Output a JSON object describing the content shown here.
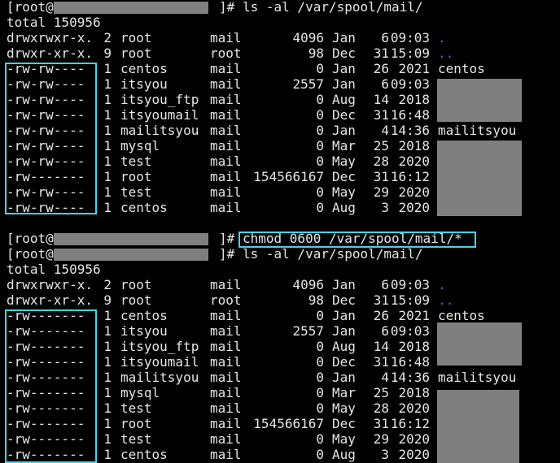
{
  "block1": {
    "prompt_user": "[root@",
    "prompt_tail": "]#",
    "command": "ls -al /var/spool/mail/",
    "total": "total 150956",
    "rows": [
      {
        "perm": "drwxrwxr-x.",
        "links": "2",
        "owner": "root",
        "group": "mail",
        "size": "4096",
        "month": "Jan",
        "day": "6",
        "time": "09:03",
        "name": "."
      },
      {
        "perm": "drwxr-xr-x.",
        "links": "9",
        "owner": "root",
        "group": "root",
        "size": "98",
        "month": "Dec",
        "day": "31",
        "time": "15:09",
        "name": ".."
      },
      {
        "perm": "-rw-rw----",
        "links": "1",
        "owner": "centos",
        "group": "mail",
        "size": "0",
        "month": "Jan",
        "day": "26",
        "time": "2021",
        "name": "centos"
      },
      {
        "perm": "-rw-rw----",
        "links": "1",
        "owner": "itsyou",
        "group": "mail",
        "size": "2557",
        "month": "Jan",
        "day": "6",
        "time": "09:03",
        "name": ""
      },
      {
        "perm": "-rw-rw----",
        "links": "1",
        "owner": "itsyou_ftp",
        "group": "mail",
        "size": "0",
        "month": "Aug",
        "day": "14",
        "time": "2018",
        "name": ""
      },
      {
        "perm": "-rw-rw----",
        "links": "1",
        "owner": "itsyoumail",
        "group": "mail",
        "size": "0",
        "month": "Dec",
        "day": "31",
        "time": "16:48",
        "name": ""
      },
      {
        "perm": "-rw-rw----",
        "links": "1",
        "owner": "mailitsyou",
        "group": "mail",
        "size": "0",
        "month": "Jan",
        "day": "4",
        "time": "14:36",
        "name": "mailitsyou"
      },
      {
        "perm": "-rw-rw----",
        "links": "1",
        "owner": "mysql",
        "group": "mail",
        "size": "0",
        "month": "Mar",
        "day": "25",
        "time": "2018",
        "name": ""
      },
      {
        "perm": "-rw-rw----",
        "links": "1",
        "owner": "test",
        "group": "mail",
        "size": "0",
        "month": "May",
        "day": "28",
        "time": "2020",
        "name": ""
      },
      {
        "perm": "-rw-------",
        "links": "1",
        "owner": "root",
        "group": "mail",
        "size": "154566167",
        "month": "Dec",
        "day": "31",
        "time": "16:12",
        "name": ""
      },
      {
        "perm": "-rw-rw----",
        "links": "1",
        "owner": "test",
        "group": "mail",
        "size": "0",
        "month": "May",
        "day": "29",
        "time": "2020",
        "name": ""
      },
      {
        "perm": "-rw-rw----",
        "links": "1",
        "owner": "centos",
        "group": "mail",
        "size": "0",
        "month": "Aug",
        "day": "3",
        "time": "2020",
        "name": ""
      }
    ]
  },
  "block2": {
    "chmod_prompt_user": "[root@",
    "chmod_prompt_tail": "]#",
    "chmod_command": "chmod 0600 /var/spool/mail/*",
    "prompt_user": "[root@",
    "prompt_tail": "]#",
    "command": "ls -al /var/spool/mail/",
    "total": "total 150956",
    "rows": [
      {
        "perm": "drwxrwxr-x.",
        "links": "2",
        "owner": "root",
        "group": "mail",
        "size": "4096",
        "month": "Jan",
        "day": "6",
        "time": "09:03",
        "name": "."
      },
      {
        "perm": "drwxr-xr-x.",
        "links": "9",
        "owner": "root",
        "group": "root",
        "size": "98",
        "month": "Dec",
        "day": "31",
        "time": "15:09",
        "name": ".."
      },
      {
        "perm": "-rw-------",
        "links": "1",
        "owner": "centos",
        "group": "mail",
        "size": "0",
        "month": "Jan",
        "day": "26",
        "time": "2021",
        "name": "centos"
      },
      {
        "perm": "-rw-------",
        "links": "1",
        "owner": "itsyou",
        "group": "mail",
        "size": "2557",
        "month": "Jan",
        "day": "6",
        "time": "09:03",
        "name": ""
      },
      {
        "perm": "-rw-------",
        "links": "1",
        "owner": "itsyou_ftp",
        "group": "mail",
        "size": "0",
        "month": "Aug",
        "day": "14",
        "time": "2018",
        "name": ""
      },
      {
        "perm": "-rw-------",
        "links": "1",
        "owner": "itsyoumail",
        "group": "mail",
        "size": "0",
        "month": "Dec",
        "day": "31",
        "time": "16:48",
        "name": ""
      },
      {
        "perm": "-rw-------",
        "links": "1",
        "owner": "mailitsyou",
        "group": "mail",
        "size": "0",
        "month": "Jan",
        "day": "4",
        "time": "14:36",
        "name": "mailitsyou"
      },
      {
        "perm": "-rw-------",
        "links": "1",
        "owner": "mysql",
        "group": "mail",
        "size": "0",
        "month": "Mar",
        "day": "25",
        "time": "2018",
        "name": ""
      },
      {
        "perm": "-rw-------",
        "links": "1",
        "owner": "test",
        "group": "mail",
        "size": "0",
        "month": "May",
        "day": "28",
        "time": "2020",
        "name": ""
      },
      {
        "perm": "-rw-------",
        "links": "1",
        "owner": "root",
        "group": "mail",
        "size": "154566167",
        "month": "Dec",
        "day": "31",
        "time": "16:12",
        "name": ""
      },
      {
        "perm": "-rw-------",
        "links": "1",
        "owner": "test",
        "group": "mail",
        "size": "0",
        "month": "May",
        "day": "29",
        "time": "2020",
        "name": ""
      },
      {
        "perm": "-rw-------",
        "links": "1",
        "owner": "centos",
        "group": "mail",
        "size": "0",
        "month": "Aug",
        "day": "3",
        "time": "2020",
        "name": ""
      }
    ]
  },
  "colors": {
    "background": "#000000",
    "text": "#e6e6e6",
    "highlight_box": "#3fd6e6",
    "dot_entries": "#3a6fd1",
    "redaction": "#7f7f7f"
  }
}
